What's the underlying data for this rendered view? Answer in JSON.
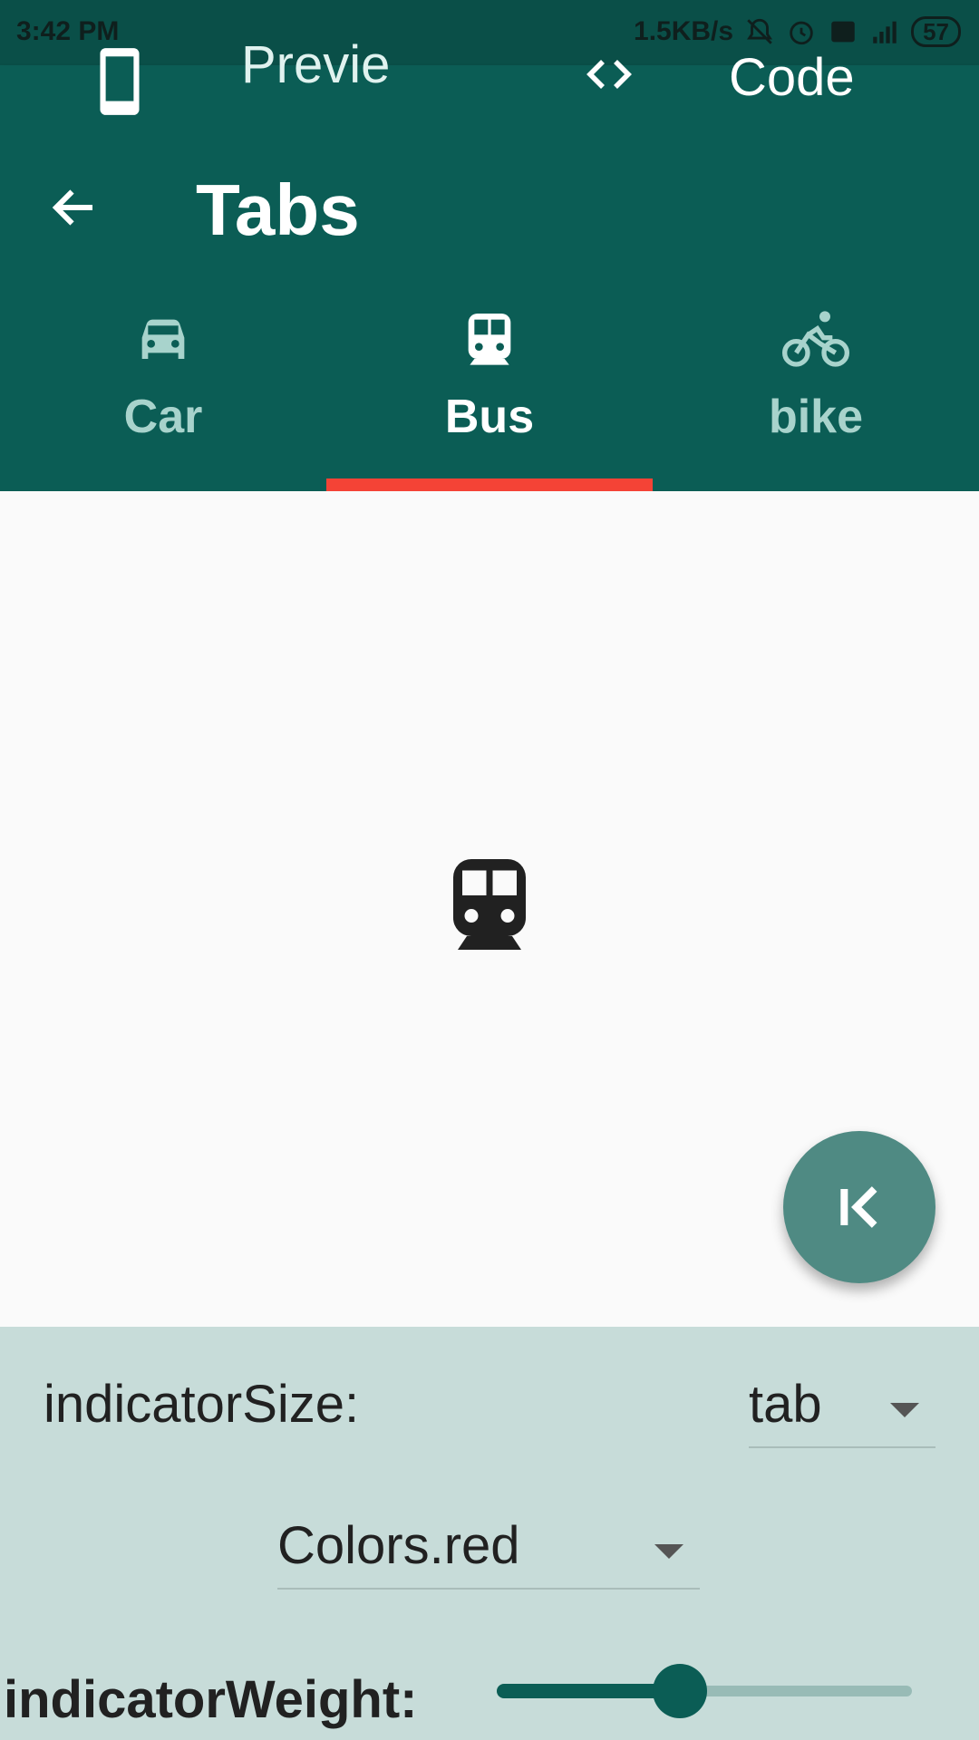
{
  "status_bar": {
    "time": "3:42 PM",
    "speed": "1.5KB/s",
    "battery": "57"
  },
  "toolbar": {
    "preview_label": "Previe\nw",
    "code_label": "Code"
  },
  "app_bar": {
    "title": "Tabs"
  },
  "tabs": [
    {
      "label": "Car",
      "icon": "car-icon",
      "selected": false
    },
    {
      "label": "Bus",
      "icon": "bus-icon",
      "selected": true
    },
    {
      "label": "bike",
      "icon": "bike-icon",
      "selected": false
    }
  ],
  "content": {
    "icon": "bus-icon"
  },
  "fab": {
    "icon": "first-page-icon"
  },
  "controls": {
    "indicator_size_label": "indicatorSize:",
    "indicator_size_value": "tab",
    "indicator_color_value": "Colors.red",
    "indicator_weight_label": "indicatorWeight:",
    "indicator_weight_level": 0.44
  },
  "colors": {
    "primary": "#0b5d55",
    "indicator": "#f44336",
    "panel": "#c7dcd9",
    "fab": "#4f8a83"
  }
}
